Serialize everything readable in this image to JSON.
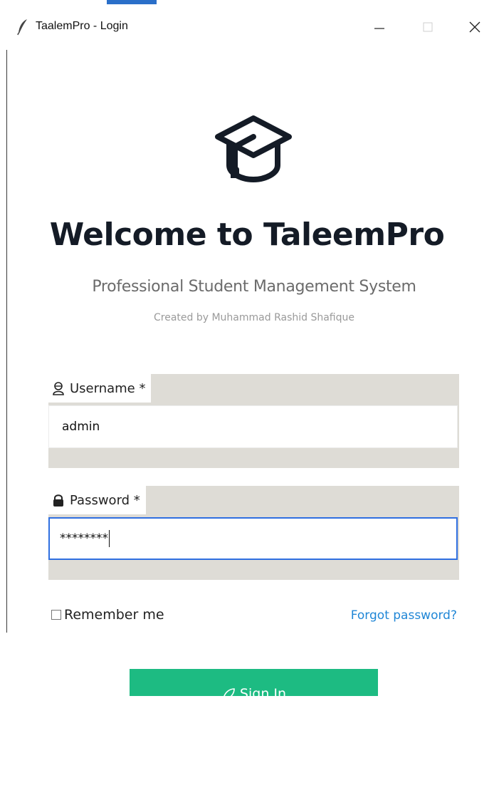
{
  "window": {
    "title": "TaalemPro - Login",
    "controls": [
      "minimize",
      "maximize",
      "close"
    ]
  },
  "hero": {
    "icon": "graduation-cap-icon",
    "heading": "Welcome to TaleemPro",
    "subtitle": "Professional Student Management System",
    "credit": "Created by Muhammad Rashid Shafique"
  },
  "form": {
    "username": {
      "label": "Username *",
      "icon": "user-icon",
      "value": "admin"
    },
    "password": {
      "label": "Password *",
      "icon": "lock-icon",
      "value": "********"
    },
    "remember_label": "Remember me",
    "forgot_label": "Forgot password?",
    "signin_label": "Sign In"
  },
  "colors": {
    "accent_green": "#1dbb82",
    "link_blue": "#1f86d6",
    "focus_blue": "#2f6fe0",
    "field_group_bg": "#dedcd6"
  }
}
